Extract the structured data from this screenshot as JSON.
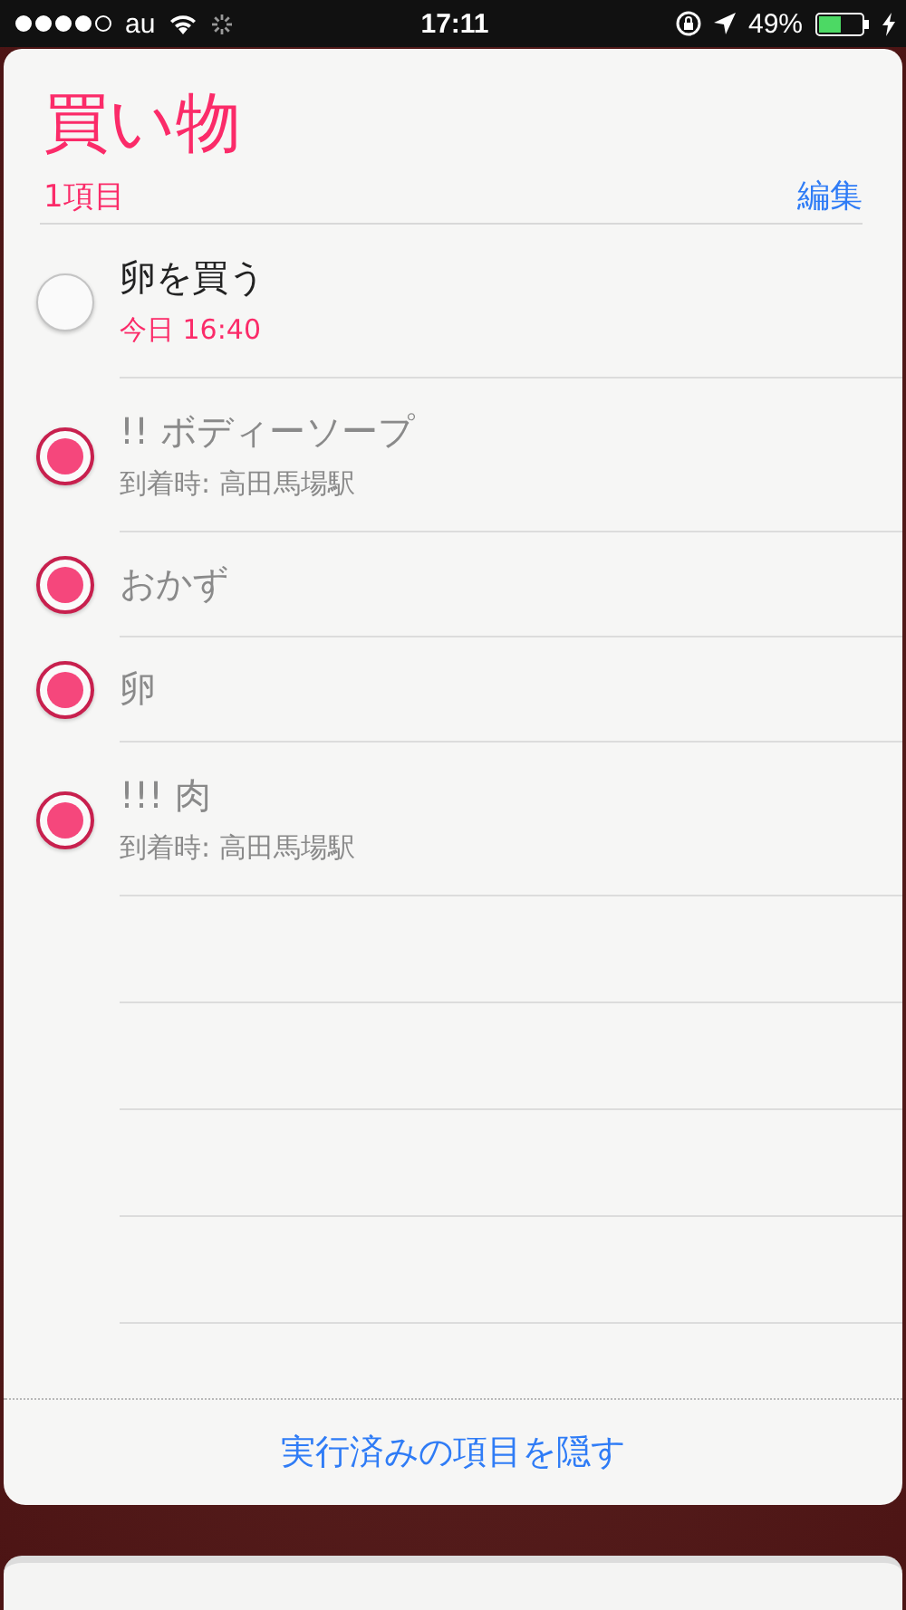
{
  "status_bar": {
    "carrier": "au",
    "time": "17:11",
    "battery": "49%"
  },
  "list": {
    "title": "買い物",
    "count": "1項目",
    "edit": "編集"
  },
  "items": [
    {
      "title": "卵を買う",
      "checked": false,
      "subtitle": {
        "kind": "due",
        "text": "今日 16:40"
      }
    },
    {
      "title": "!! ボディーソープ",
      "checked": true,
      "subtitle": {
        "kind": "location",
        "text": "到着時: 高田馬場駅"
      }
    },
    {
      "title": "おかず",
      "checked": true
    },
    {
      "title": "卵",
      "checked": true
    },
    {
      "title": "!!! 肉",
      "checked": true,
      "subtitle": {
        "kind": "location",
        "text": "到着時: 高田馬場駅"
      }
    }
  ],
  "footer": {
    "hide_completed": "実行済みの項目を隠す"
  }
}
